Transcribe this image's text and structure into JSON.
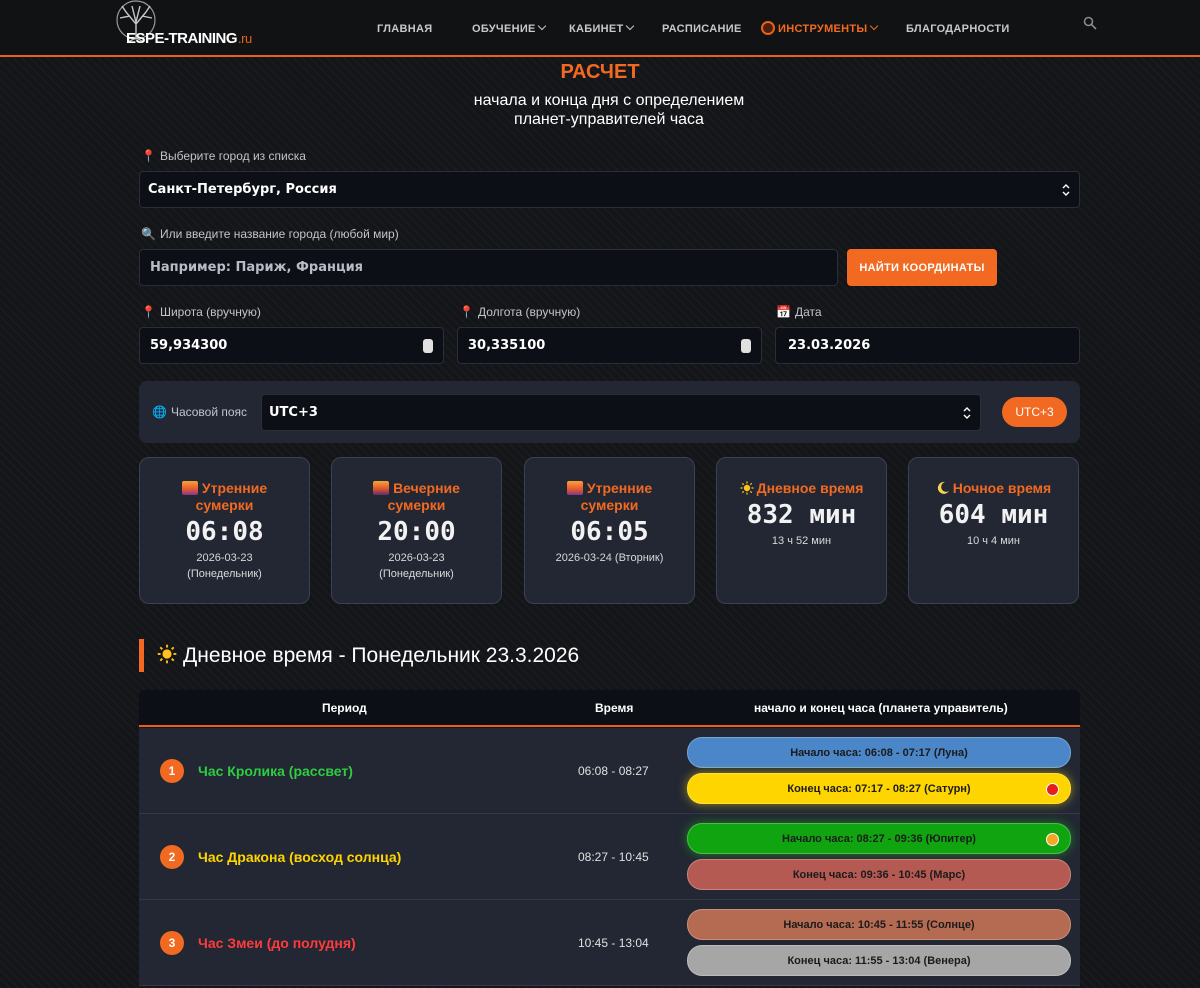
{
  "nav": {
    "logo_main": "ESPE-TRAINING",
    "logo_suffix": ".ru",
    "items": [
      {
        "label": "ГЛАВНАЯ"
      },
      {
        "label": "ОБУЧЕНИЕ"
      },
      {
        "label": "КАБИНЕТ"
      },
      {
        "label": "РАСПИСАНИЕ"
      },
      {
        "label": "ИНСТРУМЕНТЫ"
      },
      {
        "label": "БЛАГОДАРНОСТИ"
      }
    ]
  },
  "header": {
    "title": "РАСЧЕТ",
    "subtitle_line1": "начала и конца дня с определением",
    "subtitle_line2": "планет-управителей часа"
  },
  "form": {
    "city_label": "Выберите город из списка",
    "city_value": "Санкт-Петербург, Россия",
    "search_label": "Или введите название города (любой мир)",
    "search_placeholder": "Например: Париж, Франция",
    "find_button": "НАЙТИ КООРДИНАТЫ",
    "lat_label": "Широта (вручную)",
    "lat_value": "59,934300",
    "lon_label": "Долгота (вручную)",
    "lon_value": "30,335100",
    "date_label": "Дата",
    "date_value": "23.03.2026",
    "tz_label": "Часовой пояс",
    "tz_value": "UTC+3",
    "tz_badge": "UTC+3"
  },
  "cards": [
    {
      "title": "Утренние сумерки",
      "value": "06:08",
      "sub1": "2026-03-23",
      "sub2": "(Понедельник)"
    },
    {
      "title": "Вечерние сумерки",
      "value": "20:00",
      "sub1": "2026-03-23",
      "sub2": "(Понедельник)"
    },
    {
      "title": "Утренние сумерки",
      "value": "06:05",
      "sub1": "2026-03-24 (Вторник)",
      "sub2": ""
    },
    {
      "title": "Дневное время",
      "value": "832 мин",
      "sub1": "13 ч 52 мин",
      "sub2": ""
    },
    {
      "title": "Ночное время",
      "value": "604 мин",
      "sub1": "10 ч 4 мин",
      "sub2": ""
    }
  ],
  "section": {
    "title": "Дневное время - Понедельник 23.3.2026"
  },
  "table": {
    "headers": [
      "Период",
      "Время",
      "начало и конец часа (планета управитель)"
    ],
    "rows": [
      {
        "num": "1",
        "name": "Час Кролика (рассвет)",
        "time": "06:08 - 08:27",
        "name_color": "#2ecc40",
        "start": "Начало часа: 06:08 - 07:17 (Луна)",
        "start_color": "#4a86c8",
        "end": "Конец часа: 07:17 - 08:27 (Сатурн)",
        "end_color": "#ffd500"
      },
      {
        "num": "2",
        "name": "Час Дракона (восход солнца)",
        "time": "08:27 - 10:45",
        "name_color": "#ffd500",
        "start": "Начало часа: 08:27 - 09:36 (Юпитер)",
        "start_color": "#10a510",
        "end": "Конец часа: 09:36 - 10:45 (Марс)",
        "end_color": "#b55a52"
      },
      {
        "num": "3",
        "name": "Час Змеи (до полудня)",
        "time": "10:45 - 13:04",
        "name_color": "#ff3b3b",
        "start": "Начало часа: 10:45 - 11:55 (Солнце)",
        "start_color": "#b56a52",
        "end": "Конец часа: 11:55 - 13:04 (Венера)",
        "end_color": "#a6a6a6"
      }
    ]
  },
  "colors": {
    "accent": "#f26a21",
    "background": "#141518",
    "card": "#222733"
  }
}
